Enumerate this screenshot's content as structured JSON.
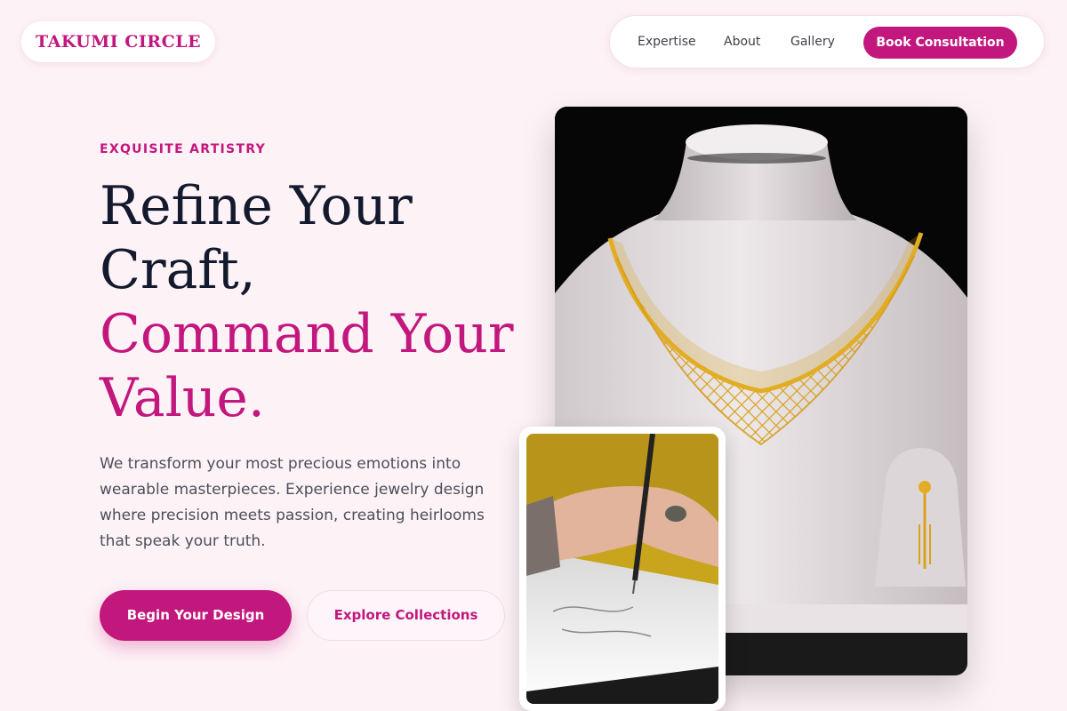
{
  "brand": {
    "name": "TAKUMI CIRCLE",
    "accent": "#c2187e",
    "background": "#fdf2f6"
  },
  "nav": {
    "links": [
      "Expertise",
      "About",
      "Gallery"
    ],
    "cta": "Book Consultation"
  },
  "hero": {
    "eyebrow": "EXQUISITE ARTISTRY",
    "headline_lines": [
      "Refine Your",
      "Craft,"
    ],
    "headline_accent_lines": [
      "Command Your",
      "Value."
    ],
    "description": "We transform your most precious emotions into wearable masterpieces. Experience jewelry design where precision meets passion, creating heirlooms that speak your truth.",
    "primary_cta": "Begin Your Design",
    "secondary_cta": "Explore Collections"
  },
  "images": {
    "main": "gold-necklace-on-bust-photo",
    "inset": "hand-sketching-design-photo"
  }
}
